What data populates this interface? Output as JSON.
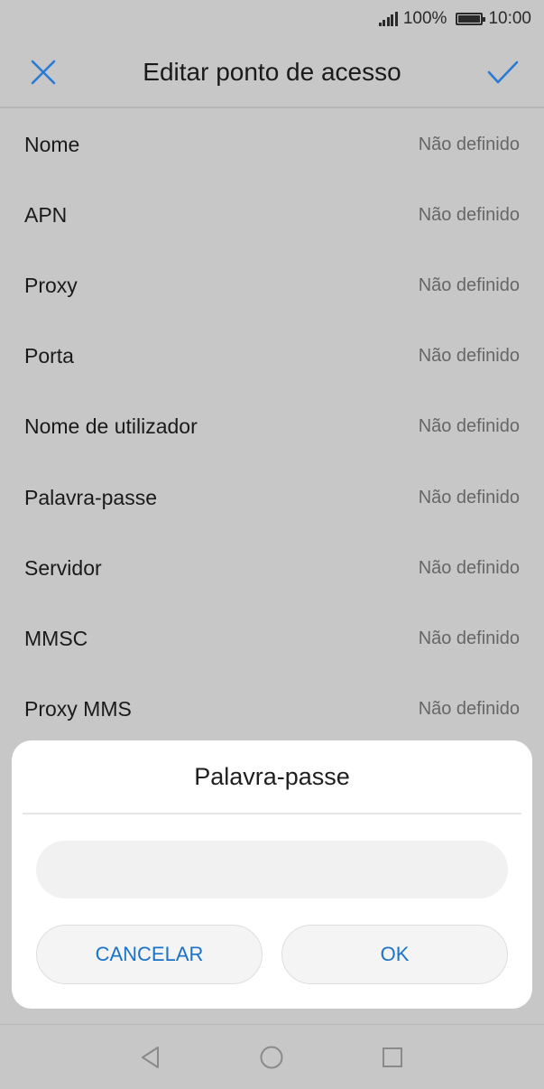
{
  "status_bar": {
    "signal_icon": "signal-bars-icon",
    "battery_percent": "100%",
    "battery_icon": "battery-full-icon",
    "time": "10:00"
  },
  "header": {
    "title": "Editar ponto de acesso",
    "close_icon": "close-icon",
    "confirm_icon": "check-icon",
    "accent_color": "#2a7ad3"
  },
  "settings": [
    {
      "label": "Nome",
      "value": "Não definido"
    },
    {
      "label": "APN",
      "value": "Não definido"
    },
    {
      "label": "Proxy",
      "value": "Não definido"
    },
    {
      "label": "Porta",
      "value": "Não definido"
    },
    {
      "label": "Nome de utilizador",
      "value": "Não definido"
    },
    {
      "label": "Palavra-passe",
      "value": "Não definido"
    },
    {
      "label": "Servidor",
      "value": "Não definido"
    },
    {
      "label": "MMSC",
      "value": "Não definido"
    },
    {
      "label": "Proxy MMS",
      "value": "Não definido"
    }
  ],
  "dialog": {
    "title": "Palavra-passe",
    "input_value": "",
    "cancel_label": "CANCELAR",
    "ok_label": "OK",
    "button_color": "#1a73c9"
  },
  "nav_bar": {
    "back_icon": "back-triangle-icon",
    "home_icon": "home-circle-icon",
    "recent_icon": "recent-square-icon"
  }
}
